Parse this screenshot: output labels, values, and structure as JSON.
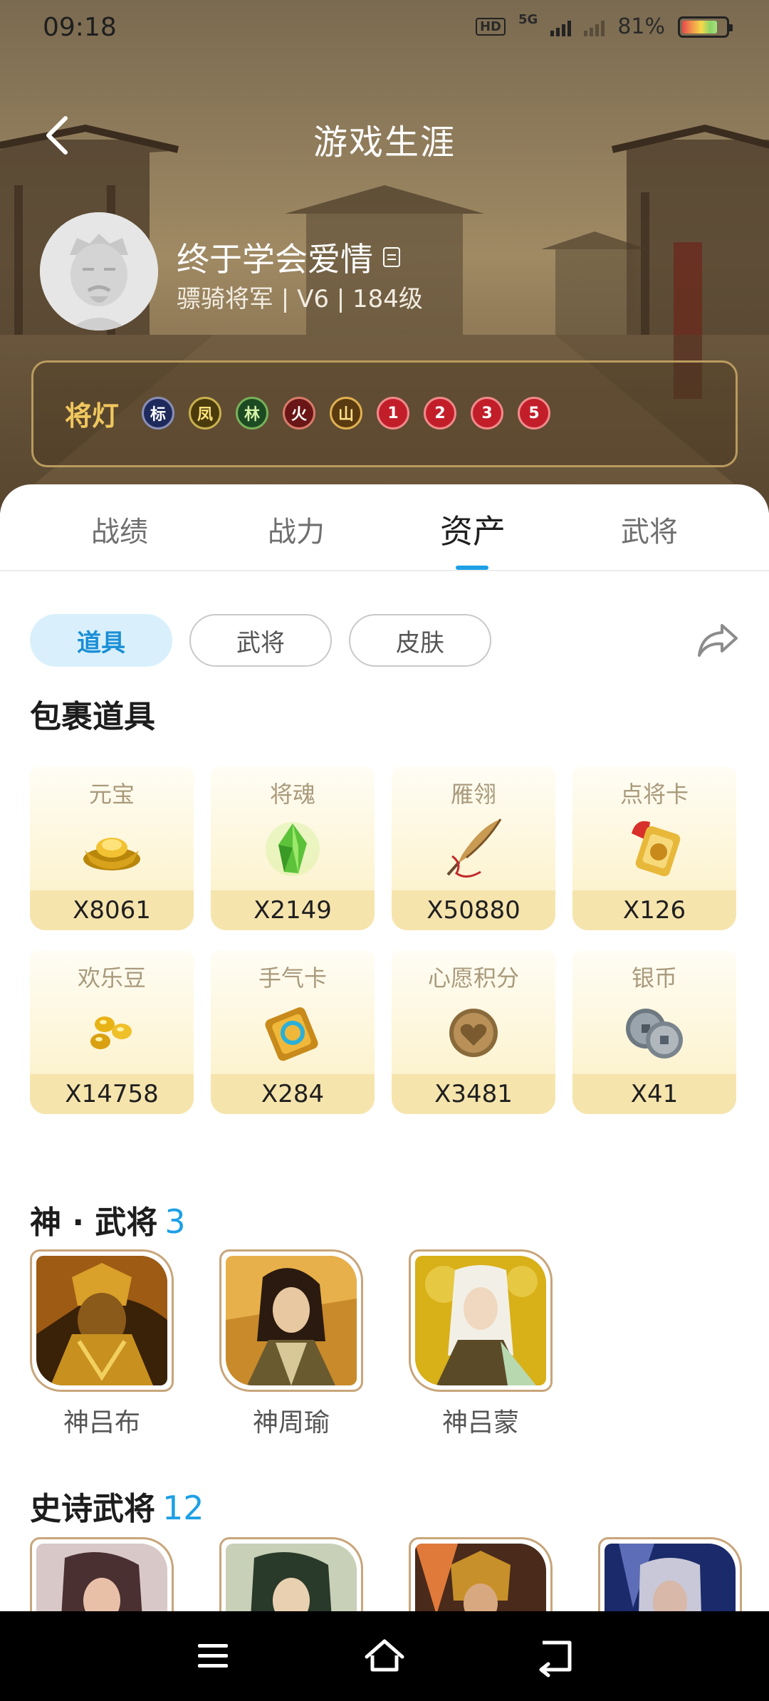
{
  "status_bar": {
    "time": "09:18",
    "hd": "HD",
    "network": "5G",
    "battery_percent": "81%"
  },
  "header": {
    "title": "游戏生涯"
  },
  "profile": {
    "username": "终于学会爱情",
    "rank_line": "骠骑将军 | V6 | 184级"
  },
  "lamps": {
    "label": "将灯",
    "badges": [
      "标",
      "凤",
      "林",
      "火",
      "山",
      "1",
      "2",
      "3",
      "5"
    ]
  },
  "tabs": [
    "战绩",
    "战力",
    "资产",
    "武将"
  ],
  "active_tab": "资产",
  "chips": [
    "道具",
    "武将",
    "皮肤"
  ],
  "active_chip": "道具",
  "bag": {
    "title": "包裹道具",
    "items": [
      {
        "name": "元宝",
        "count": "X8061",
        "icon": "gold-ingot-icon"
      },
      {
        "name": "将魂",
        "count": "X2149",
        "icon": "green-crystal-icon"
      },
      {
        "name": "雁翎",
        "count": "X50880",
        "icon": "feather-quill-icon"
      },
      {
        "name": "点将卡",
        "count": "X126",
        "icon": "general-card-icon"
      },
      {
        "name": "欢乐豆",
        "count": "X14758",
        "icon": "golden-beans-icon"
      },
      {
        "name": "手气卡",
        "count": "X284",
        "icon": "luck-card-icon"
      },
      {
        "name": "心愿积分",
        "count": "X3481",
        "icon": "heart-coin-icon"
      },
      {
        "name": "银币",
        "count": "X41",
        "icon": "silver-coins-icon"
      }
    ]
  },
  "god_generals": {
    "title": "神 · 武将",
    "count": "3",
    "heroes": [
      {
        "name": "神吕布",
        "colors": [
          "#6b3a10",
          "#c98a2a",
          "#2a1a08"
        ]
      },
      {
        "name": "神周瑜",
        "colors": [
          "#b36a18",
          "#e8b04a",
          "#3a2a1a"
        ]
      },
      {
        "name": "神吕蒙",
        "colors": [
          "#c8a018",
          "#efe3a2",
          "#5a4a20"
        ]
      }
    ]
  },
  "epic_generals": {
    "title": "史诗武将",
    "count": "12",
    "heroes": [
      {
        "colors": [
          "#5a4a50",
          "#d8c8c8",
          "#3a2a2a"
        ]
      },
      {
        "colors": [
          "#3a5a5a",
          "#c8d0b8",
          "#2a3a3a"
        ]
      },
      {
        "colors": [
          "#3a1a18",
          "#e07a3a",
          "#6a3a20"
        ]
      },
      {
        "colors": [
          "#1a2a6a",
          "#7a8ad8",
          "#0a1440"
        ]
      }
    ]
  },
  "colors": {
    "accent": "#1ea0e6",
    "lamp_label": "#f0c75e"
  }
}
